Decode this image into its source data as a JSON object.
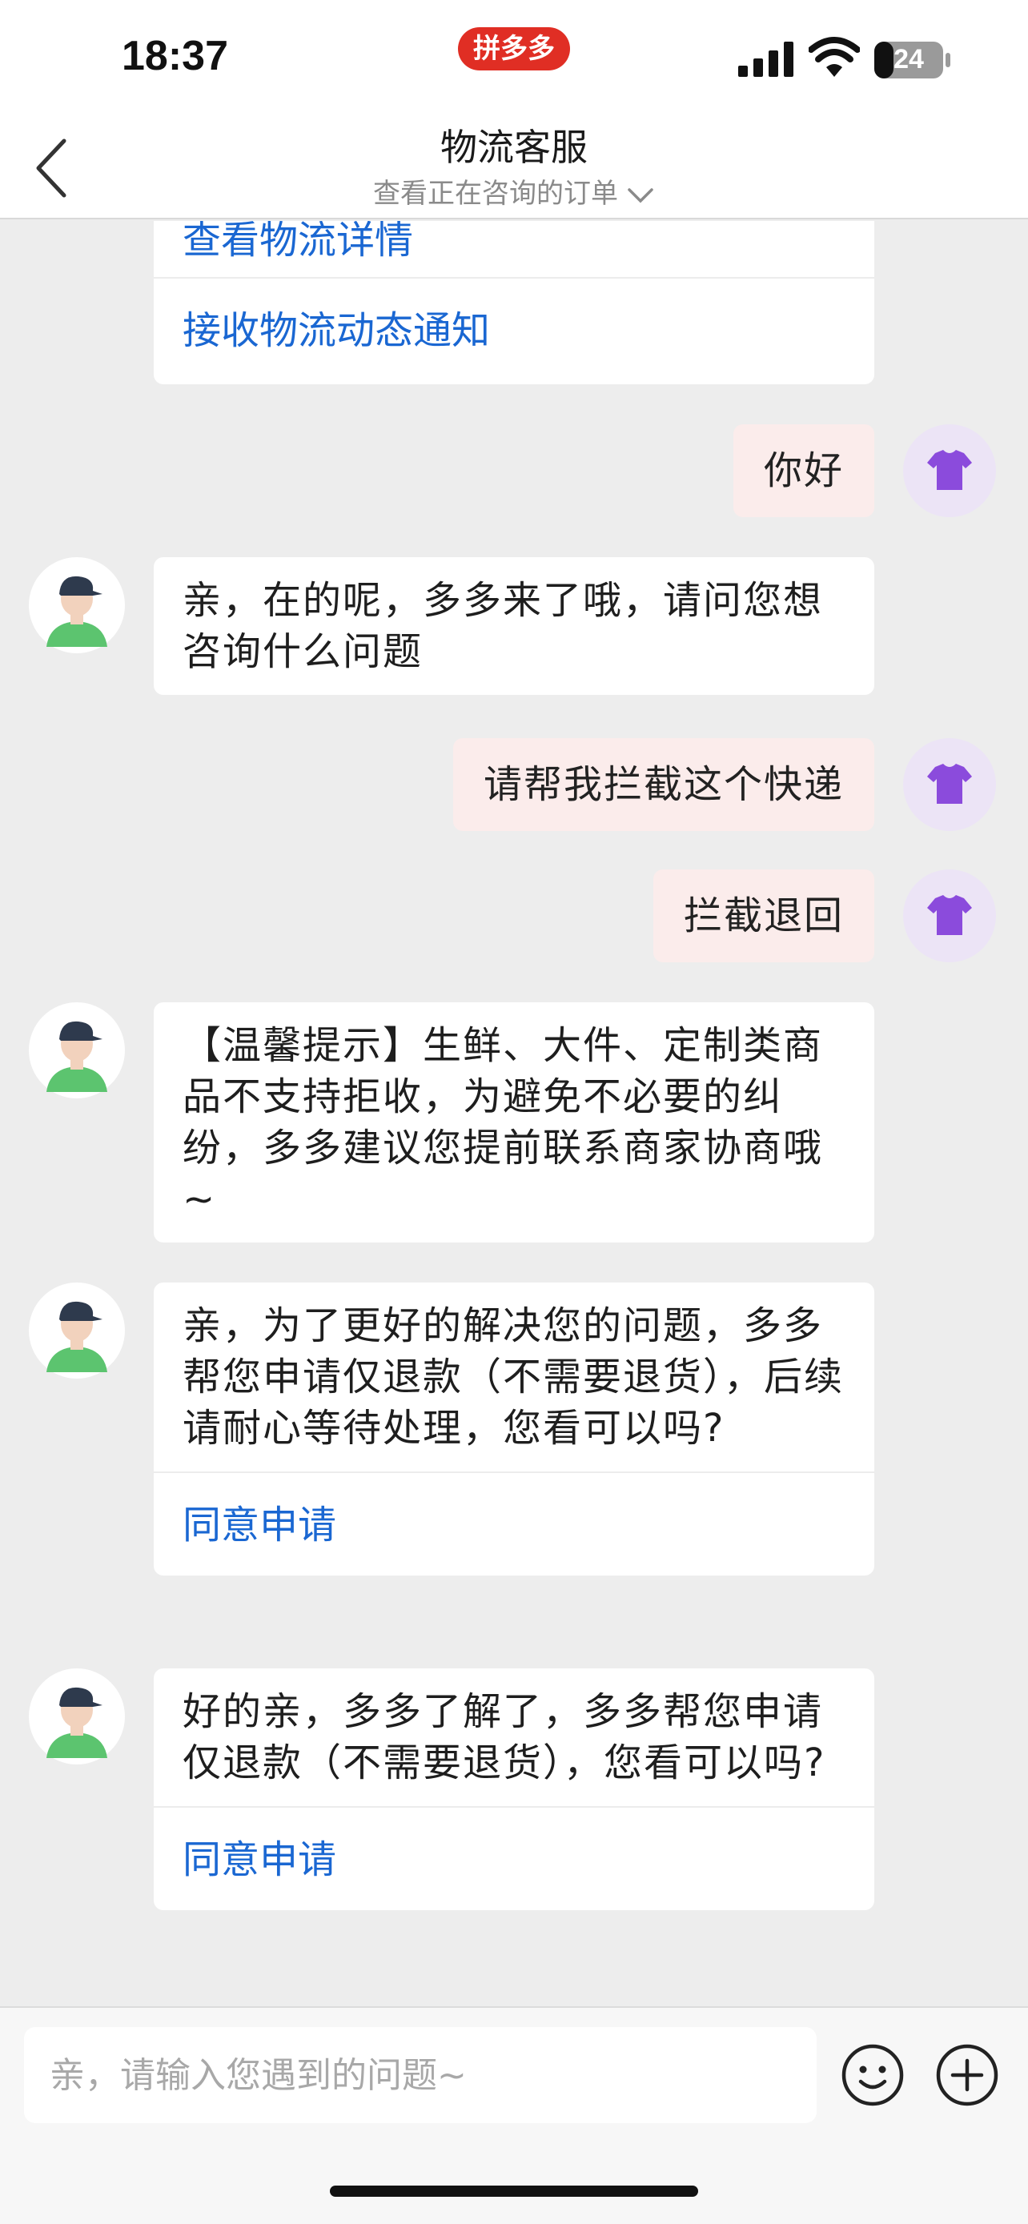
{
  "status_bar": {
    "time": "18:37",
    "app_badge": "拼多多",
    "battery": "24"
  },
  "header": {
    "title": "物流客服",
    "subtitle": "查看正在咨询的订单"
  },
  "messages": {
    "top_card": {
      "link1": "查看物流详情",
      "link2": "接收物流动态通知"
    },
    "user1": "你好",
    "agent1": "亲，在的呢，多多来了哦，请问您想咨询什么问题",
    "user2": "请帮我拦截这个快递",
    "user3": "拦截退回",
    "agent2": "【温馨提示】生鲜、大件、定制类商品不支持拒收，为避免不必要的纠纷，多多建议您提前联系商家协商哦~",
    "agent3": {
      "text": "亲，为了更好的解决您的问题，多多帮您申请仅退款（不需要退货），后续请耐心等待处理，您看可以吗?",
      "action": "同意申请"
    },
    "agent4": {
      "text": "好的亲，多多了解了，多多帮您申请仅退款（不需要退货），您看可以吗?",
      "action": "同意申请"
    }
  },
  "input": {
    "placeholder": "亲，请输入您遇到的问题~"
  },
  "icons": {
    "back": "back-chevron-icon",
    "user_avatar": "tshirt-icon",
    "agent_avatar": "agent-avatar-icon",
    "emoji": "emoji-icon",
    "plus": "plus-icon"
  },
  "colors": {
    "link": "#1a67d2",
    "brand": "#e02e24",
    "user_bubble": "#fbeceb"
  }
}
